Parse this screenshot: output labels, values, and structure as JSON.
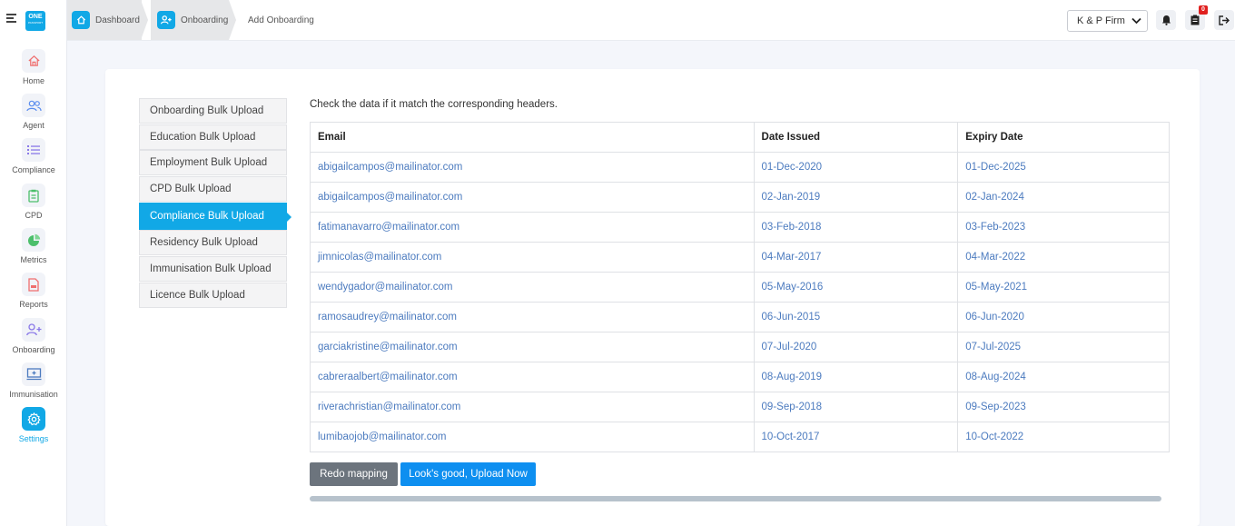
{
  "logo": {
    "line1": "ONE",
    "line2": "PASSPORT"
  },
  "sidebar": {
    "items": [
      {
        "label": "Home",
        "icon": "home-icon",
        "active": false
      },
      {
        "label": "Agent",
        "icon": "users-icon",
        "active": false
      },
      {
        "label": "Compliance",
        "icon": "list-icon",
        "active": false
      },
      {
        "label": "CPD",
        "icon": "clipboard-icon",
        "active": false
      },
      {
        "label": "Metrics",
        "icon": "pie-chart-icon",
        "active": false
      },
      {
        "label": "Reports",
        "icon": "file-icon",
        "active": false
      },
      {
        "label": "Onboarding",
        "icon": "user-plus-icon",
        "active": false
      },
      {
        "label": "Immunisation",
        "icon": "monitor-icon",
        "active": false
      },
      {
        "label": "Settings",
        "icon": "gear-icon",
        "active": true
      }
    ]
  },
  "breadcrumb": {
    "dashboard": "Dashboard",
    "onboarding": "Onboarding",
    "current": "Add Onboarding"
  },
  "header": {
    "firm": "K & P Firm",
    "notification_badge": "0"
  },
  "tabs": [
    {
      "label": "Onboarding Bulk Upload",
      "active": false
    },
    {
      "label": "Education Bulk Upload",
      "active": false
    },
    {
      "label": "Employment Bulk Upload",
      "active": false
    },
    {
      "label": "CPD Bulk Upload",
      "active": false
    },
    {
      "label": "Compliance Bulk Upload",
      "active": true
    },
    {
      "label": "Residency Bulk Upload",
      "active": false
    },
    {
      "label": "Immunisation Bulk Upload",
      "active": false
    },
    {
      "label": "Licence Bulk Upload",
      "active": false
    }
  ],
  "main": {
    "instruction": "Check the data if it match the corresponding headers.",
    "table": {
      "headers": [
        "Email",
        "Date Issued",
        "Expiry Date"
      ],
      "rows": [
        [
          "abigailcampos@mailinator.com",
          "01-Dec-2020",
          "01-Dec-2025"
        ],
        [
          "abigailcampos@mailinator.com",
          "02-Jan-2019",
          "02-Jan-2024"
        ],
        [
          "fatimanavarro@mailinator.com",
          "03-Feb-2018",
          "03-Feb-2023"
        ],
        [
          "jimnicolas@mailinator.com",
          "04-Mar-2017",
          "04-Mar-2022"
        ],
        [
          "wendygador@mailinator.com",
          "05-May-2016",
          "05-May-2021"
        ],
        [
          "ramosaudrey@mailinator.com",
          "06-Jun-2015",
          "06-Jun-2020"
        ],
        [
          "garciakristine@mailinator.com",
          "07-Jul-2020",
          "07-Jul-2025"
        ],
        [
          "cabreraalbert@mailinator.com",
          "08-Aug-2019",
          "08-Aug-2024"
        ],
        [
          "riverachristian@mailinator.com",
          "09-Sep-2018",
          "09-Sep-2023"
        ],
        [
          "lumibaojob@mailinator.com",
          "10-Oct-2017",
          "10-Oct-2022"
        ]
      ]
    },
    "buttons": {
      "redo": "Redo mapping",
      "upload": "Look's good, Upload Now"
    },
    "progress": 1.0
  },
  "colors": {
    "accent": "#11a8e6",
    "upload": "#0e8ff0",
    "redo": "#6c747d",
    "link": "#4c7bbf"
  }
}
